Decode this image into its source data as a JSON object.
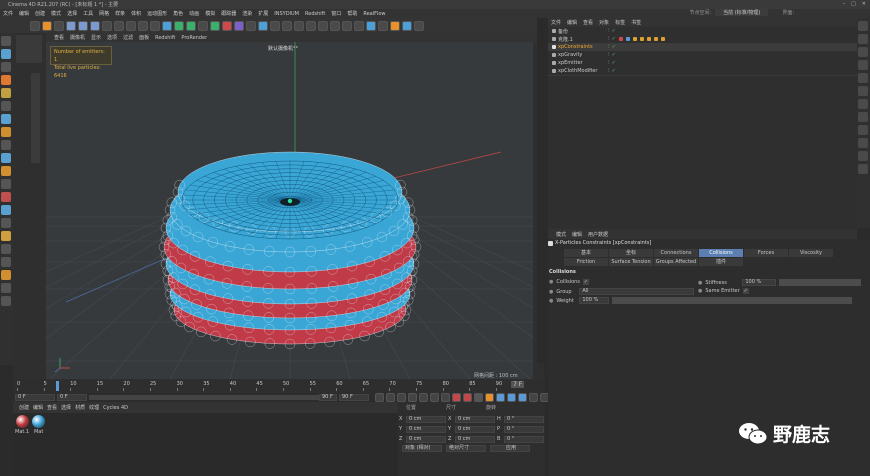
{
  "window": {
    "title": "Cinema 4D R21.207 (RC) - [未标题 1 *] - 主要"
  },
  "menubar": {
    "items": [
      "文件",
      "编辑",
      "创建",
      "模式",
      "选择",
      "工具",
      "网格",
      "样条",
      "体积",
      "运动图形",
      "角色",
      "动画",
      "模拟",
      "跟踪器",
      "渲染",
      "扩展",
      "INSYDIUM",
      "Redshift",
      "窗口",
      "帮助",
      "RealFlow"
    ],
    "layout_label": "节点空间:",
    "layout_value": "当前 (标准/物理)",
    "interface_label": "界面:"
  },
  "viewport": {
    "menu": [
      "查看",
      "摄像机",
      "显示",
      "选项",
      "过滤",
      "面板",
      "Redshift",
      "ProRender"
    ],
    "hud_line1": "Number of emitters: 1",
    "hud_line2": "Total live particles: 6416",
    "camera_label": "默认摄像机°°",
    "grid_label": "网格间距 : 100 cm"
  },
  "timeline": {
    "ticks": [
      "0",
      "5",
      "10",
      "15",
      "20",
      "25",
      "30",
      "35",
      "40",
      "45",
      "50",
      "55",
      "60",
      "65",
      "70",
      "75",
      "80",
      "85",
      "90"
    ],
    "current_frame": "7 F"
  },
  "frame_row": {
    "start": "0 F",
    "pos": "0 F",
    "end": "90 F",
    "end2": "90 F"
  },
  "material_manager": {
    "menu": [
      "创建",
      "编辑",
      "查看",
      "选择",
      "材质",
      "纹理",
      "Cycles 4D"
    ],
    "materials": [
      {
        "label": "Mat.1",
        "color": "#c23a3f"
      },
      {
        "label": "Mat",
        "color": "#3da3d8"
      }
    ]
  },
  "coordinates": {
    "headers": [
      "位置",
      "尺寸",
      "旋转"
    ],
    "rows": [
      {
        "a": "X",
        "av": "0 cm",
        "b": "X",
        "bv": "0 cm",
        "c": "H",
        "cv": "0 °"
      },
      {
        "a": "Y",
        "av": "0 cm",
        "b": "Y",
        "bv": "0 cm",
        "c": "P",
        "cv": "0 °"
      },
      {
        "a": "Z",
        "av": "0 cm",
        "b": "Z",
        "bv": "0 cm",
        "c": "B",
        "cv": "0 °"
      }
    ],
    "mode1": "对象 (相对)",
    "mode2": "绝对尺寸",
    "apply": "应用"
  },
  "object_manager": {
    "menu": [
      "文件",
      "编辑",
      "查看",
      "对象",
      "标签",
      "书签"
    ],
    "objects": [
      {
        "name": "备份",
        "selected": false
      },
      {
        "name": "克隆.1",
        "selected": false
      },
      {
        "name": "xpConstraints",
        "selected": true,
        "color": "#f0a830"
      },
      {
        "name": "xpGravity",
        "selected": false
      },
      {
        "name": "xpEmitter",
        "selected": false
      },
      {
        "name": "xpClothModifier",
        "selected": false
      }
    ]
  },
  "attribute_manager": {
    "menu": [
      "模式",
      "编辑",
      "用户数据"
    ],
    "title": "X-Particles Constraints [xpConstraints]",
    "tabs_row1": [
      "基本",
      "坐标",
      "Connections",
      "Collisions",
      "Forces",
      "Viscosity"
    ],
    "tabs_row2": [
      "Friction",
      "Surface Tension",
      "Groups Affected",
      "插件"
    ],
    "active_tab": "Collisions",
    "section": "Collisions",
    "fields": {
      "collisions_label": "Collisions",
      "collisions_checked": "✓",
      "stiffness_label": "Stiffness",
      "stiffness_value": "100 %",
      "group_label": "Group",
      "group_value": "All",
      "same_emitter_label": "Same Emitter",
      "same_emitter_checked": "✓",
      "weight_label": "Weight",
      "weight_value": "100 %"
    }
  },
  "watermark": {
    "text": "野鹿志"
  }
}
